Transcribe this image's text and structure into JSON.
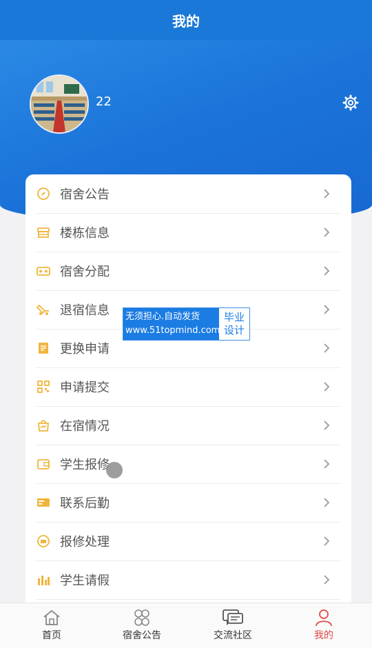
{
  "header": {
    "title": "我的"
  },
  "profile": {
    "username": "22"
  },
  "menu": {
    "items": [
      {
        "label": "宿舍公告",
        "icon": "compass-icon"
      },
      {
        "label": "楼栋信息",
        "icon": "store-icon"
      },
      {
        "label": "宿舍分配",
        "icon": "vr-glasses-icon"
      },
      {
        "label": "退宿信息",
        "icon": "truck-icon"
      },
      {
        "label": "更换申请",
        "icon": "document-icon"
      },
      {
        "label": "申请提交",
        "icon": "qrcode-icon"
      },
      {
        "label": "在宿情况",
        "icon": "bag-icon"
      },
      {
        "label": "学生报修",
        "icon": "wallet-icon"
      },
      {
        "label": "联系后勤",
        "icon": "card-icon"
      },
      {
        "label": "报修处理",
        "icon": "face-icon"
      },
      {
        "label": "学生请假",
        "icon": "bar-chart-icon"
      }
    ]
  },
  "watermark": {
    "line1": "无须担心.自动发货",
    "line2": "www.51topmind.com",
    "side1": "毕业",
    "side2": "设计"
  },
  "tabbar": {
    "tabs": [
      {
        "label": "首页"
      },
      {
        "label": "宿舍公告"
      },
      {
        "label": "交流社区"
      },
      {
        "label": "我的"
      }
    ]
  },
  "colors": {
    "primary": "#1a78d8",
    "menu_icon": "#f0b53c",
    "tab_active": "#e14747",
    "tab_inactive": "#888888"
  }
}
